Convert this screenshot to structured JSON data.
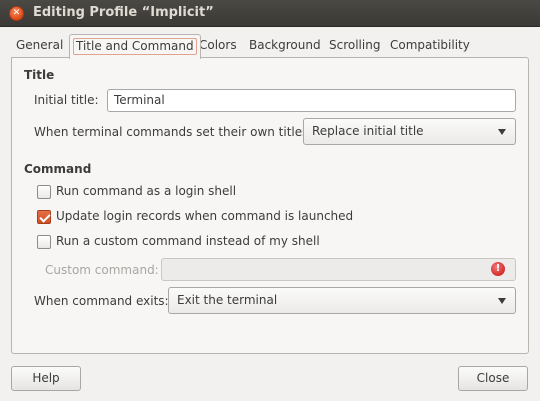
{
  "window": {
    "title": "Editing Profile “Implicit”"
  },
  "tabs": [
    {
      "label": "General",
      "active": false
    },
    {
      "label": "Title and Command",
      "active": true
    },
    {
      "label": "Colors",
      "active": false
    },
    {
      "label": "Background",
      "active": false
    },
    {
      "label": "Scrolling",
      "active": false
    },
    {
      "label": "Compatibility",
      "active": false
    }
  ],
  "title_section": {
    "heading": "Title",
    "initial_title_label": "Initial title:",
    "initial_title_value": "Terminal",
    "dynamic_title_label": "When terminal commands set their own titles:",
    "dynamic_title_value": "Replace initial title"
  },
  "command_section": {
    "heading": "Command",
    "login_shell_label": "Run command as a login shell",
    "login_shell_checked": false,
    "update_records_label": "Update login records when command is launched",
    "update_records_checked": true,
    "custom_command_label": "Run a custom command instead of my shell",
    "custom_command_checked": false,
    "custom_command_field_label": "Custom command:",
    "custom_command_value": "",
    "exit_label": "When command exits:",
    "exit_value": "Exit the terminal"
  },
  "footer": {
    "help_label": "Help",
    "close_label": "Close"
  },
  "colors": {
    "accent": "#df4a16",
    "titlebar": "#3c3b37"
  }
}
